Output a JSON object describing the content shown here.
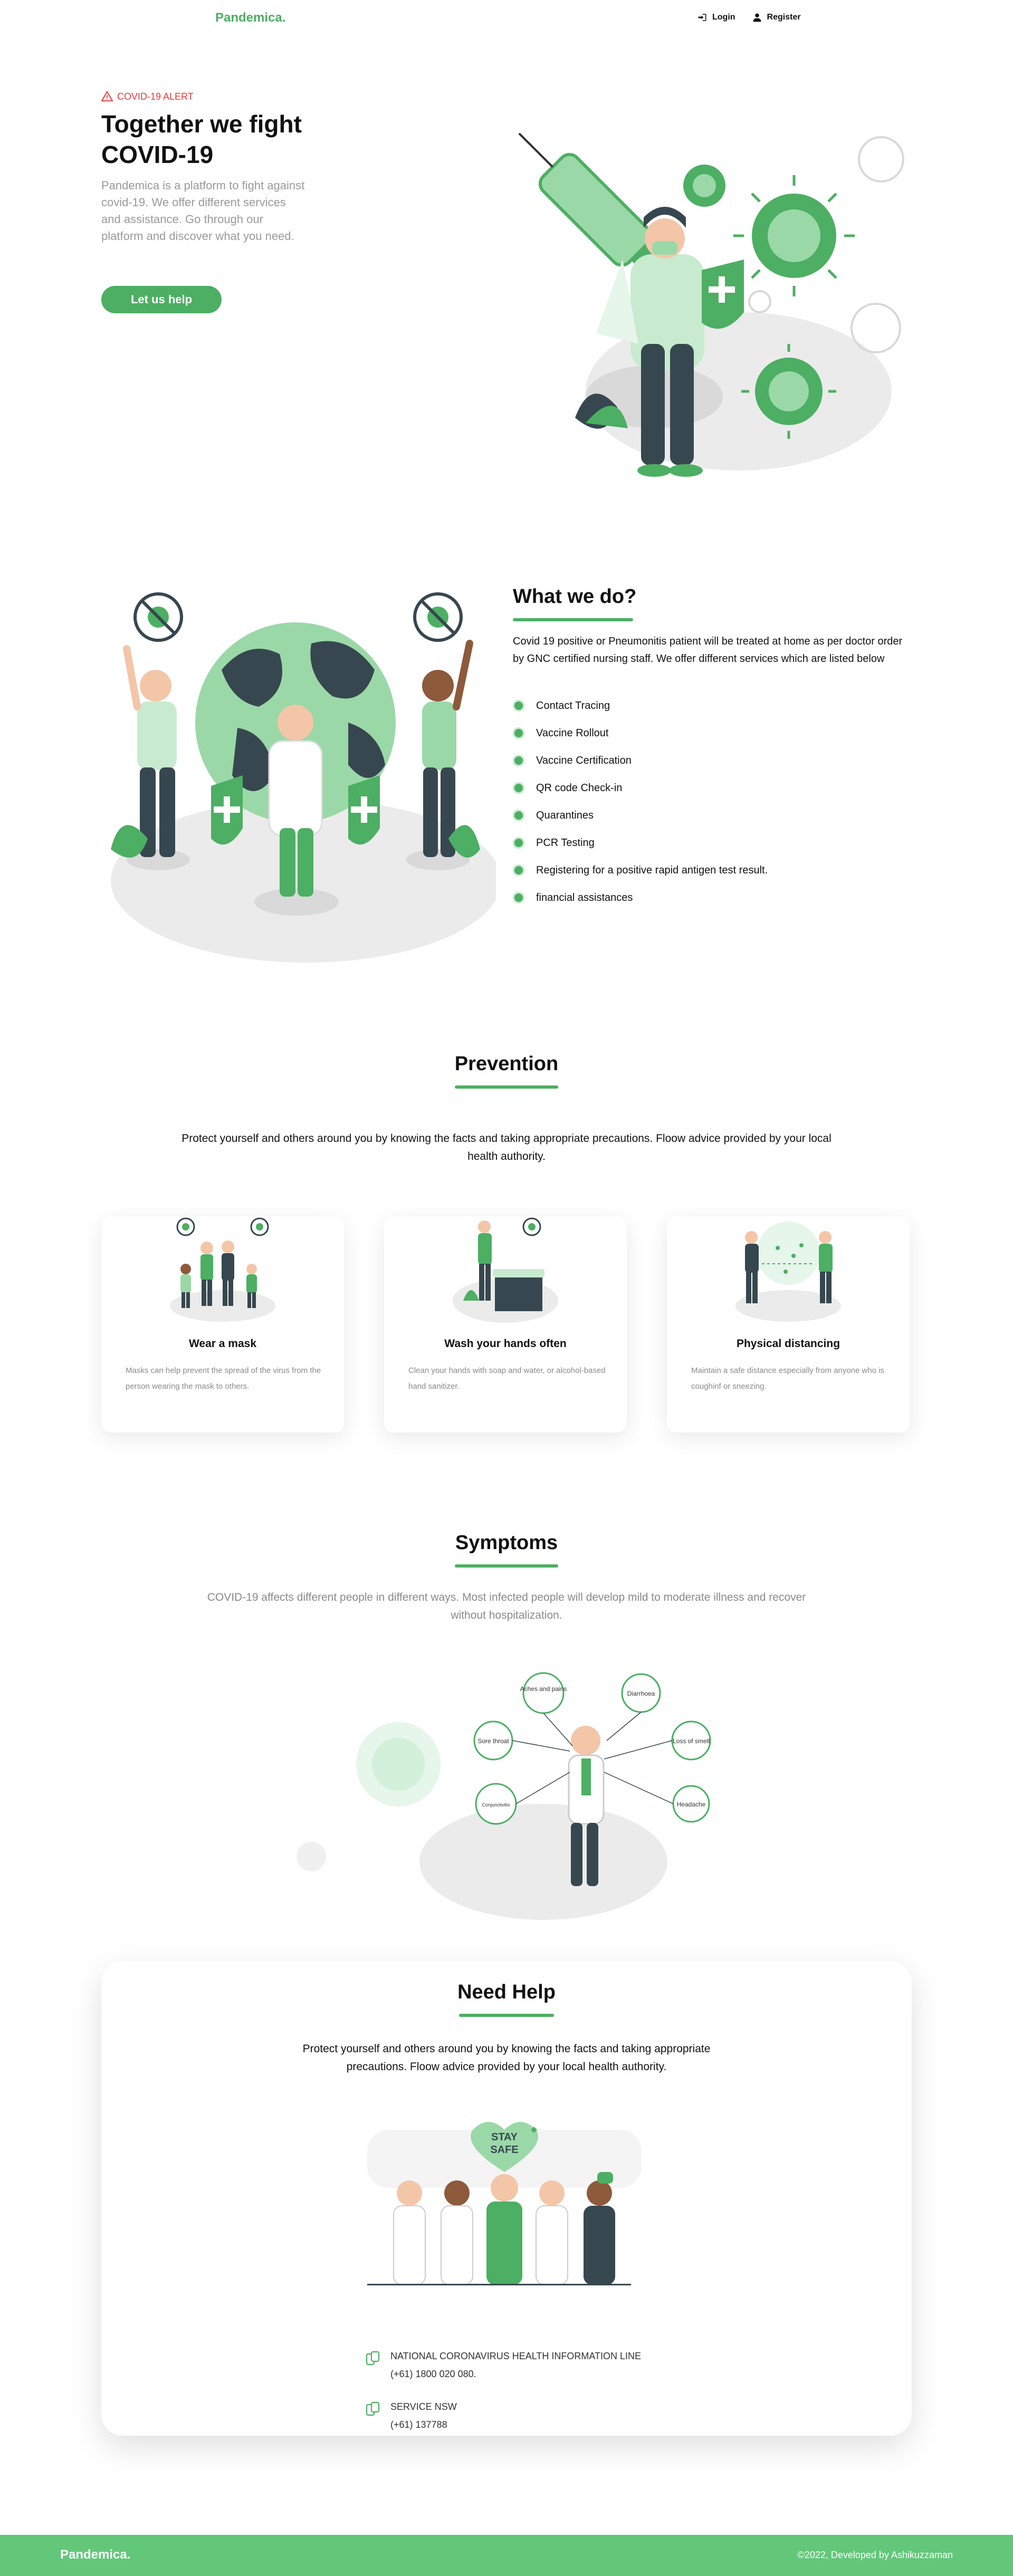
{
  "nav": {
    "logo": "Pandemica.",
    "login": "Login",
    "register": "Register",
    "login_icon": "login-icon",
    "register_icon": "user-icon"
  },
  "hero": {
    "alert": "COVID-19 ALERT",
    "alert_icon": "warning-icon",
    "title": "Together we fight COVID-19",
    "description": "Pandemica is a platform to fight against covid-19. We offer different services and assistance. Go through our platform and discover what you need.",
    "button": "Let us help"
  },
  "what_we_do": {
    "title": "What we do?",
    "description": "Covid 19 positive or Pneumonitis patient will be treated at home as per doctor order by GNC certified nursing staff. We offer different services which are listed below",
    "services": [
      "Contact Tracing",
      "Vaccine Rollout",
      "Vaccine Certification",
      "QR code Check-in",
      "Quarantines",
      "PCR Testing",
      "Registering for a positive rapid antigen test result.",
      "financial assistances"
    ]
  },
  "prevention": {
    "title": "Prevention",
    "description": "Protect yourself and others around you by knowing the facts and taking appropriate precautions. Floow advice provided by your local health authority.",
    "cards": [
      {
        "title": "Wear a mask",
        "description": "Masks can help prevent the spread of the virus from the person wearing the mask to others."
      },
      {
        "title": "Wash your hands often",
        "description": "Clean your hands with soap and water, or alcohol-based hand sanitizer."
      },
      {
        "title": "Physical distancing",
        "description": "Maintain a safe distance especially from anyone who is coughinf or sneezing."
      }
    ]
  },
  "symptoms": {
    "title": "Symptoms",
    "description": "COVID-19 affects different people in different ways. Most infected people will develop mild to moderate illness and recover without hospitalization.",
    "labels": [
      "Aches and pains",
      "Diarrhoea",
      "Sore throat",
      "Loss of smell",
      "Conjunctivitis",
      "Headache"
    ]
  },
  "need_help": {
    "title": "Need Help",
    "description": "Protect yourself and others around you by knowing the facts and taking appropriate precautions. Floow advice provided by your local health authority.",
    "badge_line1": "STAY",
    "badge_line2": "SAFE",
    "contacts": [
      {
        "name": "NATIONAL CORONAVIRUS HEALTH INFORMATION LINE",
        "phone": "(+61) 1800 020 080.",
        "icon": "phone-icon"
      },
      {
        "name": "SERVICE NSW",
        "phone": "(+61) 137788",
        "icon": "phone-icon"
      }
    ]
  },
  "footer": {
    "logo": "Pandemica.",
    "credit": "©2022, Developed by Ashikuzzaman"
  },
  "colors": {
    "brand": "#4caf63",
    "alert": "#ea3a3a",
    "footer": "#63c77a"
  }
}
